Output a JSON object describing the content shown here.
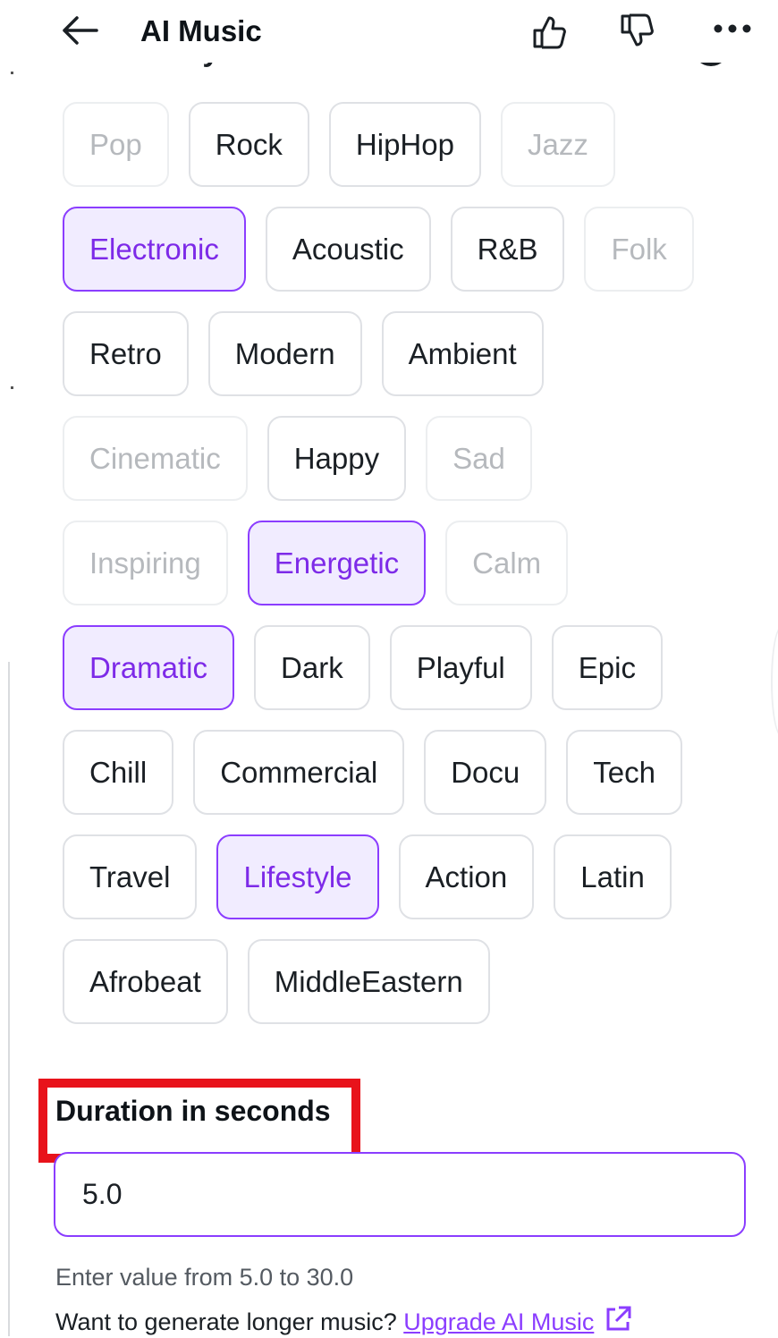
{
  "header": {
    "title": "AI Music",
    "behind_text": "Choose styles and moods"
  },
  "chips": [
    [
      {
        "label": "Pop",
        "state": "disabled"
      },
      {
        "label": "Rock",
        "state": "normal"
      },
      {
        "label": "HipHop",
        "state": "normal"
      },
      {
        "label": "Jazz",
        "state": "disabled"
      }
    ],
    [
      {
        "label": "Electronic",
        "state": "selected"
      },
      {
        "label": "Acoustic",
        "state": "normal"
      },
      {
        "label": "R&B",
        "state": "normal"
      },
      {
        "label": "Folk",
        "state": "disabled"
      }
    ],
    [
      {
        "label": "Retro",
        "state": "normal"
      },
      {
        "label": "Modern",
        "state": "normal"
      },
      {
        "label": "Ambient",
        "state": "normal"
      }
    ],
    [
      {
        "label": "Cinematic",
        "state": "disabled"
      },
      {
        "label": "Happy",
        "state": "normal"
      },
      {
        "label": "Sad",
        "state": "disabled"
      }
    ],
    [
      {
        "label": "Inspiring",
        "state": "disabled"
      },
      {
        "label": "Energetic",
        "state": "selected"
      },
      {
        "label": "Calm",
        "state": "disabled"
      }
    ],
    [
      {
        "label": "Dramatic",
        "state": "selected"
      },
      {
        "label": "Dark",
        "state": "normal"
      },
      {
        "label": "Playful",
        "state": "normal"
      },
      {
        "label": "Epic",
        "state": "normal"
      }
    ],
    [
      {
        "label": "Chill",
        "state": "normal"
      },
      {
        "label": "Commercial",
        "state": "normal"
      },
      {
        "label": "Docu",
        "state": "normal"
      },
      {
        "label": "Tech",
        "state": "normal"
      }
    ],
    [
      {
        "label": "Travel",
        "state": "normal"
      },
      {
        "label": "Lifestyle",
        "state": "selected"
      },
      {
        "label": "Action",
        "state": "normal"
      },
      {
        "label": "Latin",
        "state": "normal"
      }
    ],
    [
      {
        "label": "Afrobeat",
        "state": "normal"
      },
      {
        "label": "MiddleEastern",
        "state": "normal"
      }
    ]
  ],
  "duration": {
    "label": "Duration in seconds",
    "value": "5.0",
    "hint": "Enter value from 5.0 to 30.0",
    "upgrade_prefix": "Want to generate longer music?",
    "upgrade_link": "Upgrade AI Music"
  },
  "colors": {
    "accent": "#8b3dff",
    "selected_bg": "#f1ecff",
    "highlight": "#e8131b"
  },
  "icons": [
    "back-arrow-icon",
    "thumbs-up-icon",
    "thumbs-down-icon",
    "more-icon",
    "external-link-icon"
  ]
}
